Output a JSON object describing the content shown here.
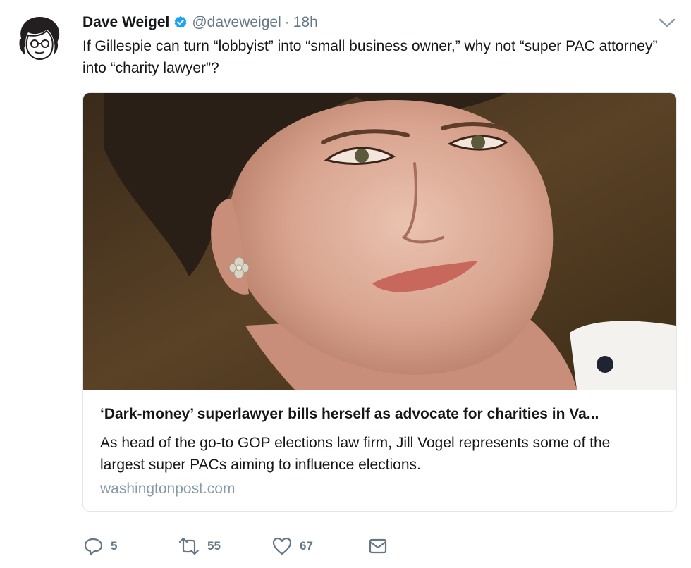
{
  "tweet": {
    "author_name": "Dave Weigel",
    "handle": "@daveweigel",
    "separator": "·",
    "time": "18h",
    "text": "If Gillespie can turn “lobbyist” into “small business owner,” why not “super PAC attorney” into “charity lawyer”?"
  },
  "card": {
    "title": "‘Dark-money’ superlawyer bills herself as advocate for charities in Va...",
    "description": "As head of the go-to GOP elections law firm, Jill Vogel represents some of the largest super PACs aiming to influence elections.",
    "domain": "washingtonpost.com"
  },
  "actions": {
    "replies": "5",
    "retweets": "55",
    "likes": "67"
  },
  "colors": {
    "verified_blue": "#1da1f2",
    "secondary_text": "#657786",
    "domain_text": "#8899a6",
    "border": "#e1e8ed"
  },
  "icons": {
    "verified": "verified-badge-icon",
    "chevron": "chevron-down-icon",
    "reply": "reply-icon",
    "retweet": "retweet-icon",
    "like": "heart-icon",
    "dm": "envelope-icon"
  }
}
